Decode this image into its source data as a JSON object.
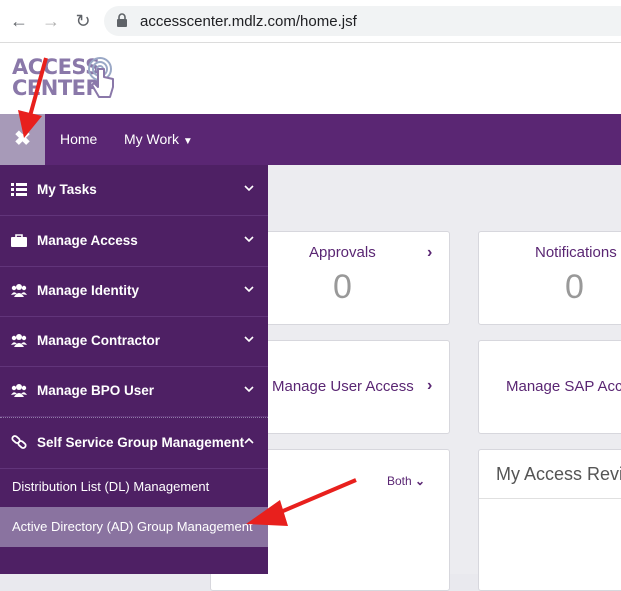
{
  "browser": {
    "url": "accesscenter.mdlz.com/home.jsf",
    "back_icon": "arrow-left-icon",
    "forward_icon": "arrow-right-icon",
    "reload_icon": "reload-icon"
  },
  "logo": {
    "line1": "ACCESS",
    "line2": "CENTER"
  },
  "top_nav": {
    "home": "Home",
    "my_work": "My Work"
  },
  "cards": {
    "approvals": {
      "title": "Approvals",
      "count": "0"
    },
    "notifications": {
      "title": "Notifications",
      "count": "0"
    },
    "manage_user_access": {
      "title": "Manage User Access"
    },
    "manage_sap": {
      "title": "Manage SAP Acc"
    },
    "filter": {
      "label": "Both"
    },
    "my_access_review": {
      "title": "My Access Revi"
    }
  },
  "sidebar": {
    "items": [
      {
        "label": "My Tasks",
        "icon": "list-icon"
      },
      {
        "label": "Manage Access",
        "icon": "briefcase-icon"
      },
      {
        "label": "Manage Identity",
        "icon": "users-icon"
      },
      {
        "label": "Manage Contractor",
        "icon": "users-icon"
      },
      {
        "label": "Manage BPO User",
        "icon": "users-icon"
      },
      {
        "label": "Self Service Group Management",
        "icon": "link-icon"
      }
    ],
    "sub_items": [
      {
        "label": "Distribution List (DL) Management"
      },
      {
        "label": "Active Directory (AD) Group Management"
      }
    ]
  },
  "colors": {
    "brand_purple": "#5a2673",
    "sidebar_bg": "#4e2064",
    "active_item": "#8a73a0",
    "annotation_arrow": "#e8201d"
  }
}
